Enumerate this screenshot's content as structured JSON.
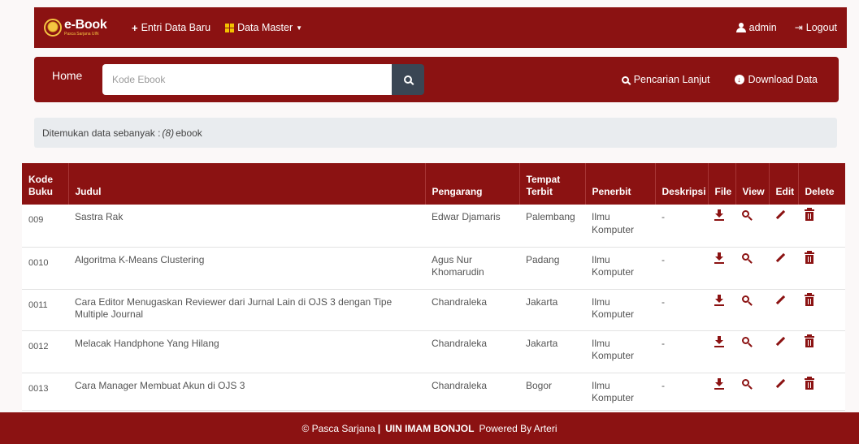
{
  "navbar": {
    "brand": "e-Book",
    "brand_sub": "Pasca Sarjana UIN",
    "entri_label": "Entri Data Baru",
    "master_label": "Data Master",
    "user_label": "admin",
    "logout_label": "Logout"
  },
  "searchbar": {
    "home_label": "Home",
    "placeholder": "Kode Ebook",
    "advanced_label": "Pencarian Lanjut",
    "download_label": "Download Data"
  },
  "alert": {
    "prefix": "Ditemukan data sebanyak :",
    "count": "(8)",
    "suffix": "ebook"
  },
  "table": {
    "headers": {
      "kode": "Kode Buku",
      "judul": "Judul",
      "pengarang": "Pengarang",
      "tempat": "Tempat Terbit",
      "penerbit": "Penerbit",
      "deskripsi": "Deskripsi",
      "file": "File",
      "view": "View",
      "edit": "Edit",
      "delete": "Delete"
    },
    "rows": [
      {
        "kode": "009",
        "judul": "Sastra Rak",
        "pengarang": "Edwar Djamaris",
        "tempat": "Palembang",
        "penerbit": "Ilmu Komputer",
        "deskripsi": "-"
      },
      {
        "kode": "0010",
        "judul": "Algoritma K-Means Clustering",
        "pengarang": "Agus Nur Khomarudin",
        "tempat": "Padang",
        "penerbit": "Ilmu Komputer",
        "deskripsi": "-"
      },
      {
        "kode": "0011",
        "judul": "Cara Editor Menugaskan Reviewer dari Jurnal Lain di OJS 3 dengan Tipe Multiple Journal",
        "pengarang": "Chandraleka",
        "tempat": "Jakarta",
        "penerbit": "Ilmu Komputer",
        "deskripsi": "-"
      },
      {
        "kode": "0012",
        "judul": "Melacak Handphone Yang Hilang",
        "pengarang": "Chandraleka",
        "tempat": "Jakarta",
        "penerbit": "Ilmu Komputer",
        "deskripsi": "-"
      },
      {
        "kode": "0013",
        "judul": "Cara Manager Membuat Akun di OJS 3",
        "pengarang": "Chandraleka",
        "tempat": "Bogor",
        "penerbit": "Ilmu Komputer",
        "deskripsi": "-"
      }
    ]
  },
  "footer": {
    "copyright": "© Pasca Sarjana",
    "separator": "|",
    "org": "UIN IMAM BONJOL",
    "powered": "Powered By Arteri"
  }
}
